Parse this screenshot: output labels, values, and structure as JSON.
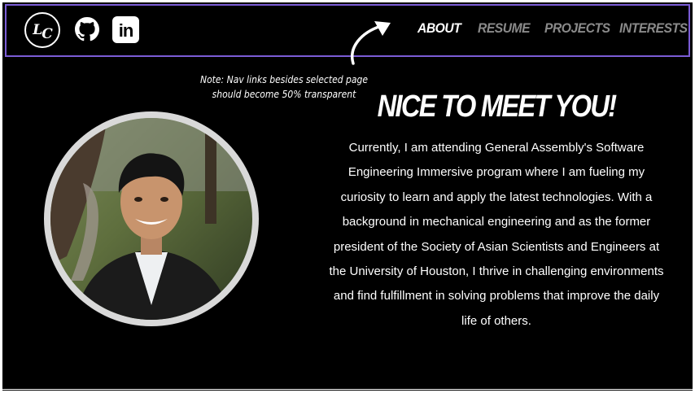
{
  "header": {
    "logo_text_l": "L",
    "logo_text_c": "C",
    "nav": [
      {
        "label": "ABOUT",
        "selected": true
      },
      {
        "label": "RESUME",
        "selected": false
      },
      {
        "label": "PROJECTS",
        "selected": false
      },
      {
        "label": "INTERESTS",
        "selected": false
      }
    ],
    "social_icons": [
      "github-icon",
      "linkedin-icon"
    ],
    "linkedin_text": "in"
  },
  "note": {
    "line1": "Note: Nav links besides selected page",
    "line2": "should become 50% transparent"
  },
  "about": {
    "heading": "NICE TO MEET YOU!",
    "bio": "Currently, I am attending General Assembly's Software Engineering Immersive program where I am fueling my curiosity to learn and apply the latest technologies. With a background in mechanical engineering and as the former president of the Society of Asian Scientists and Engineers at the University of Houston, I thrive in challenging environments and find fulfillment in solving problems that improve the daily life of others."
  },
  "colors": {
    "background": "#000000",
    "text": "#ffffff",
    "nav_border": "#7b5cd6",
    "nav_inactive": "#8a8a8a",
    "photo_ring": "#d9d9d9"
  }
}
